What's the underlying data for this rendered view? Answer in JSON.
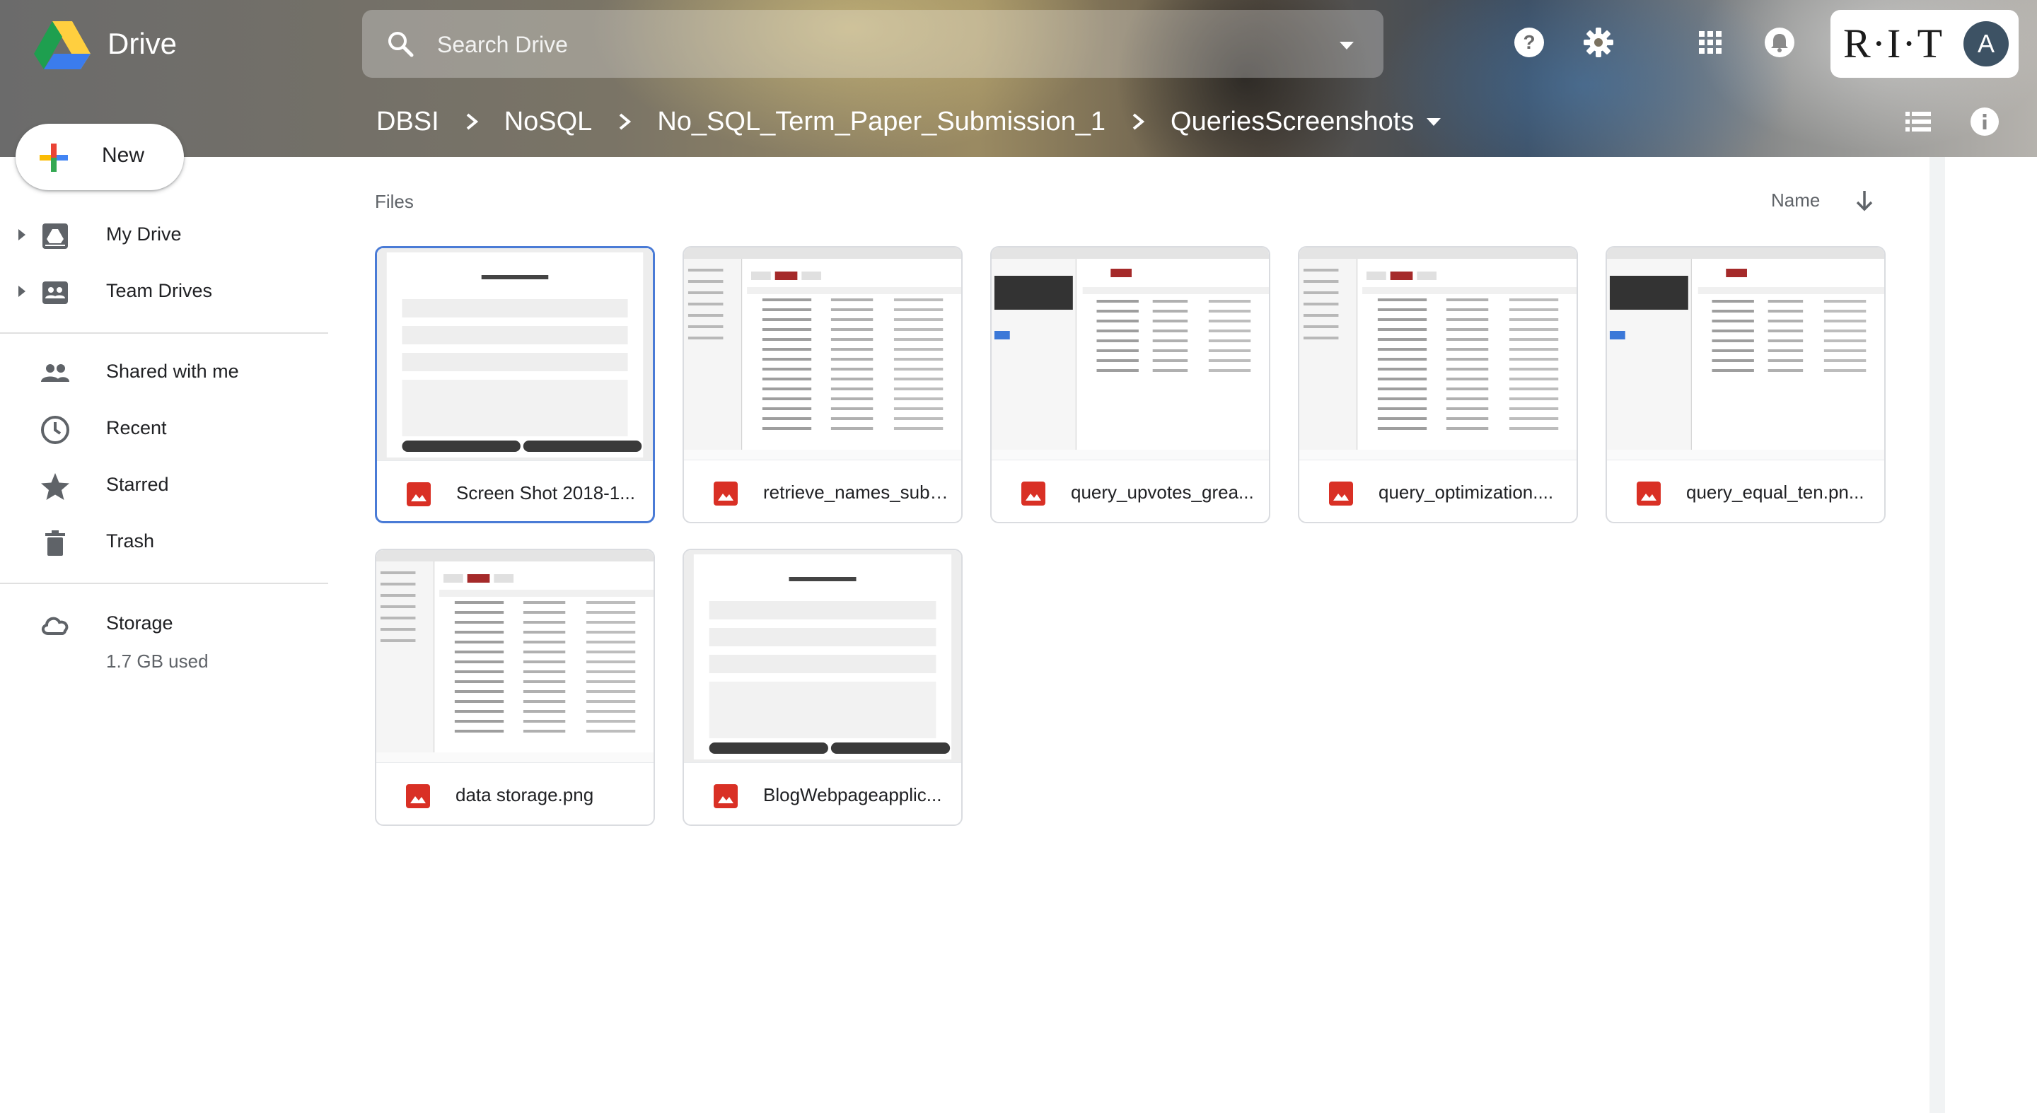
{
  "header": {
    "app_name": "Drive",
    "search_placeholder": "Search Drive",
    "org_logo_text": "R·I·T",
    "avatar_initial": "A"
  },
  "breadcrumb": [
    "DBSI",
    "NoSQL",
    "No_SQL_Term_Paper_Submission_1",
    "QueriesScreenshots"
  ],
  "sidebar": {
    "new_label": "New",
    "items": [
      {
        "label": "My Drive",
        "icon": "my-drive-icon"
      },
      {
        "label": "Team Drives",
        "icon": "team-drives-icon"
      },
      {
        "label": "Shared with me",
        "icon": "people-icon"
      },
      {
        "label": "Recent",
        "icon": "clock-icon"
      },
      {
        "label": "Starred",
        "icon": "star-icon"
      },
      {
        "label": "Trash",
        "icon": "trash-icon"
      },
      {
        "label": "Storage",
        "icon": "cloud-icon"
      }
    ],
    "storage_used": "1.7 GB used"
  },
  "main": {
    "section_title": "Files",
    "sort_label": "Name",
    "files": [
      {
        "name": "Screen Shot 2018-1...",
        "preview": "form"
      },
      {
        "name": "retrieve_names_subj...",
        "preview": "table"
      },
      {
        "name": "query_upvotes_grea...",
        "preview": "query"
      },
      {
        "name": "query_optimization....",
        "preview": "table"
      },
      {
        "name": "query_equal_ten.pn...",
        "preview": "query"
      },
      {
        "name": "data storage.png",
        "preview": "table"
      },
      {
        "name": "BlogWebpageapplic...",
        "preview": "form"
      }
    ]
  },
  "colors": {
    "accent_blue": "#4a7bd6",
    "image_file_red": "#d93025",
    "thumbnail_tab_red": "#a52a2a"
  }
}
